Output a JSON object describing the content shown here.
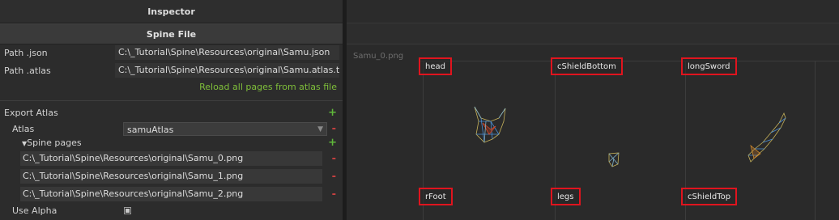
{
  "inspector": {
    "title": "Inspector",
    "section_title": "Spine File",
    "path_json_label": "Path .json",
    "path_json_value": "C:\\_Tutorial\\Spine\\Resources\\original\\Samu.json",
    "path_atlas_label": "Path .atlas",
    "path_atlas_value": "C:\\_Tutorial\\Spine\\Resources\\original\\Samu.atlas.t",
    "reload_label": "Reload all pages from atlas file",
    "export_atlas_label": "Export Atlas",
    "atlas_label": "Atlas",
    "atlas_selected": "samuAtlas",
    "spine_pages_label": "Spine pages",
    "pages": [
      "C:\\_Tutorial\\Spine\\Resources\\original\\Samu_0.png",
      "C:\\_Tutorial\\Spine\\Resources\\original\\Samu_1.png",
      "C:\\_Tutorial\\Spine\\Resources\\original\\Samu_2.png"
    ],
    "use_alpha_label": "Use Alpha",
    "use_alpha_checked": true
  },
  "viewport": {
    "atlas_page_name": "Samu_0.png",
    "regions": [
      "head",
      "cShieldBottom",
      "longSword",
      "rFoot",
      "legs",
      "cShieldTop"
    ]
  },
  "colors": {
    "add": "#5fb83a",
    "remove": "#c84040",
    "link": "#7fbf3a",
    "highlight": "#e0141e"
  },
  "icons": {
    "add": "+",
    "remove": "-",
    "expand": "▼",
    "dropdown": "▼"
  }
}
